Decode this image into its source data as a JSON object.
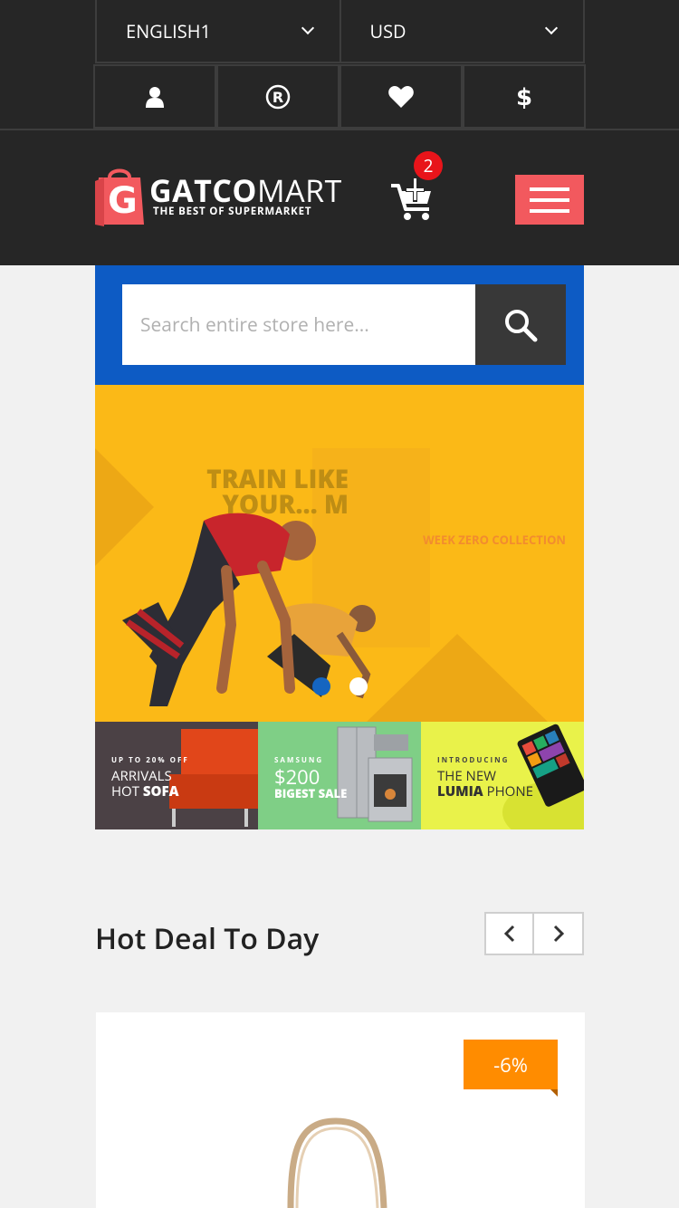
{
  "topbar": {
    "language": "ENGLISH1",
    "currency": "USD"
  },
  "quick_icons": [
    "user-icon",
    "registered-icon",
    "heart-icon",
    "dollar-icon"
  ],
  "brand": {
    "name_part1": "GATCO",
    "name_part2": "MART",
    "tagline": "THE BEST OF SUPERMARKET",
    "logo_letter": "G",
    "accent_color": "#f2595e"
  },
  "cart": {
    "count": "2"
  },
  "search": {
    "placeholder": "Search entire store here..."
  },
  "hero": {
    "title": "TRAIN LIKE YOUR... M",
    "subtitle": "WEEK ZERO COLLECTION",
    "dots": [
      {
        "active": true
      },
      {
        "active": false
      }
    ]
  },
  "promos": [
    {
      "small": "UP TO 20% OFF",
      "line1": "ARRIVALS",
      "line2a": "HOT ",
      "line2b": "SOFA"
    },
    {
      "small": "SAMSUNG",
      "line1": "$200",
      "line2a": "",
      "line2b": "BIGEST SALE"
    },
    {
      "small": "INTRODUCING",
      "line1": "THE NEW",
      "line2a": "",
      "line2b": "LUMIA",
      "line2c": " PHONE"
    }
  ],
  "hot_deal": {
    "title": "Hot Deal To Day",
    "badge": "-6%"
  }
}
